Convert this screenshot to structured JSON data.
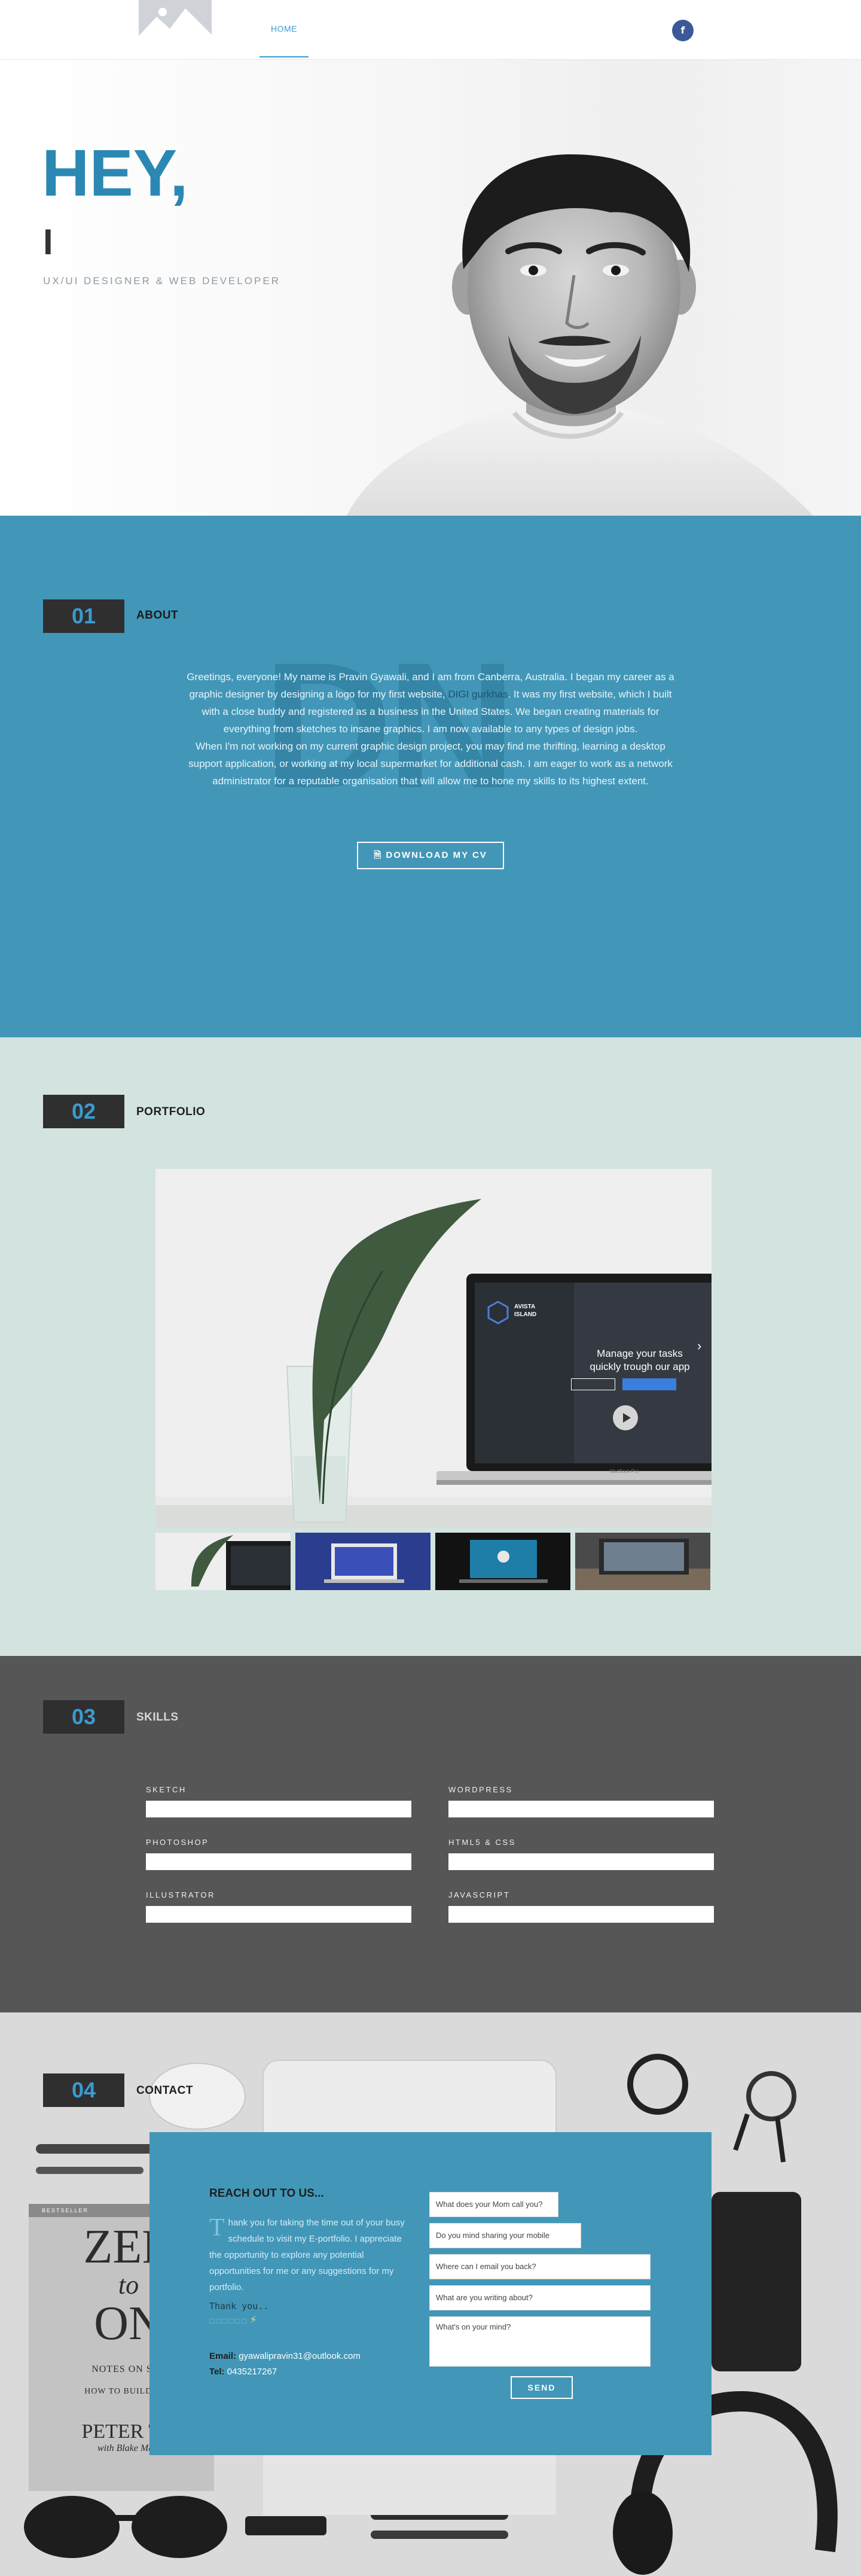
{
  "header": {
    "nav_home": "HOME",
    "social_icon": "facebook-icon",
    "social_glyph": "f"
  },
  "hero": {
    "title": "HEY,",
    "typed": "I",
    "subtitle": "UX/UI DESIGNER & WEB DEVELOPER"
  },
  "about": {
    "number": "01",
    "title": "ABOUT",
    "watermark": "DN",
    "para1_a": "Greetings, everyone! My name is Pravin Gyawali, and I am from Canberra, Australia. I began my career as a graphic designer by designing a logo for my first website, ",
    "para1_link": "DIGI gurkhas",
    "para1_b": ". It was my first website, which I built with a close buddy and registered as a business in the United States. We began creating materials for everything from sketches to insane graphics. I am now available to any types of design jobs.",
    "para2": "When I'm not working on my current graphic design project, you may find me thrifting, learning a desktop support application, or working at my local supermarket for additional cash. I am eager to work as a network administrator for a reputable organisation that will allow me to hone my skills to its highest extent.",
    "cv_button": "DOWNLOAD MY CV",
    "cv_icon": "document-icon"
  },
  "portfolio": {
    "number": "02",
    "title": "PORTFOLIO",
    "laptop_brand": "AVISTA ISLAND",
    "laptop_headline_1": "Manage your tasks",
    "laptop_headline_2": "quickly trough our app",
    "laptop_model": "MacBook Pro"
  },
  "skills": {
    "number": "03",
    "title": "SKILLS",
    "items": [
      {
        "label": "SKETCH",
        "level": 1.0
      },
      {
        "label": "WORDPRESS",
        "level": 1.0
      },
      {
        "label": "PHOTOSHOP",
        "level": 1.0
      },
      {
        "label": "HTML5 & CSS",
        "level": 1.0
      },
      {
        "label": "ILLUSTRATOR",
        "level": 1.0
      },
      {
        "label": "JAVASCRIPT",
        "level": 1.0
      }
    ]
  },
  "contact": {
    "number": "04",
    "title": "CONTACT",
    "card_title": "REACH OUT TO US...",
    "drop_letter": "T",
    "body": "hank you for taking the time out of your busy schedule to visit my E-portfolio. I appreciate the opportunity to explore any potential opportunities for me or any suggestions for my portfolio.",
    "thanks": "Thank you..",
    "dots": "□□□□□□",
    "email_label": "Email:",
    "email": "gyawalipravin31@outlook.com",
    "tel_label": "Tel:",
    "tel": "0435217267",
    "field_name": "What does your Mom call you?",
    "field_phone": "Do you mind sharing your mobile number?",
    "field_email": "Where can I email you back?",
    "field_subject": "What are you writing about?",
    "field_message": "What's on your mind?",
    "send": "SEND",
    "book_title_1": "ZER",
    "book_title_2": "to",
    "book_title_3": "ON",
    "book_sub": "NOTES ON STA",
    "book_sub2": "HOW TO BUILD THE",
    "book_author": "PETER TH",
    "book_author2": "with Blake Mast",
    "book_spine": "BESTSELLER"
  },
  "colors": {
    "accent": "#3a9bd0",
    "about_bg": "#4297b8",
    "portfolio_bg": "#d3e4e0",
    "skills_bg": "#565656",
    "section_num_bg": "#2f2f2f"
  }
}
